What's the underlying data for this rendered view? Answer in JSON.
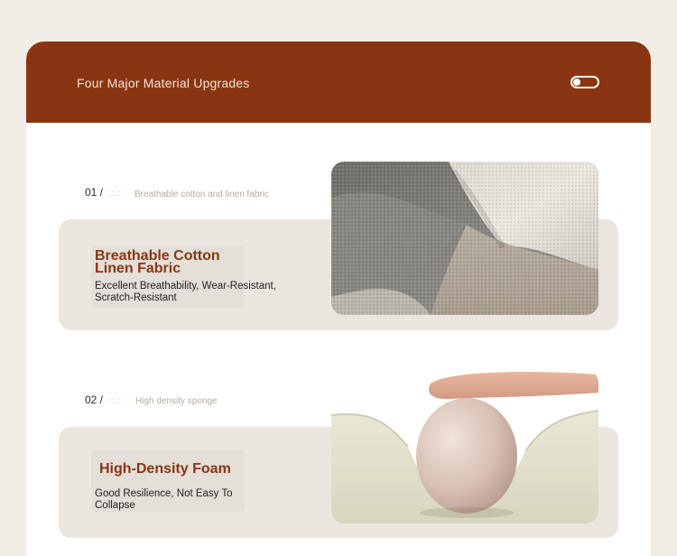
{
  "header": {
    "title": "Four Major Material Upgrades"
  },
  "features": [
    {
      "number": "01 /",
      "ghost_text": "::::",
      "subtitle": "Breathable cotton and linen fabric",
      "title_line1": "Breathable Cotton",
      "title_line2": "Linen Fabric",
      "description": "Excellent Breathability, Wear-Resistant, Scratch-Resistant",
      "image_icon": "fabric-photo"
    },
    {
      "number": "02 /",
      "ghost_text": "::::",
      "subtitle": "High density sponge",
      "title": "High-Density Foam",
      "description": "Good Resilience, Not Easy To Collapse",
      "image_icon": "foam-egg-photo"
    }
  ],
  "colors": {
    "page_background": "#f1ede6",
    "header": "#8a3511",
    "panel": "#ebe6df",
    "accent_text": "#8a3511"
  }
}
